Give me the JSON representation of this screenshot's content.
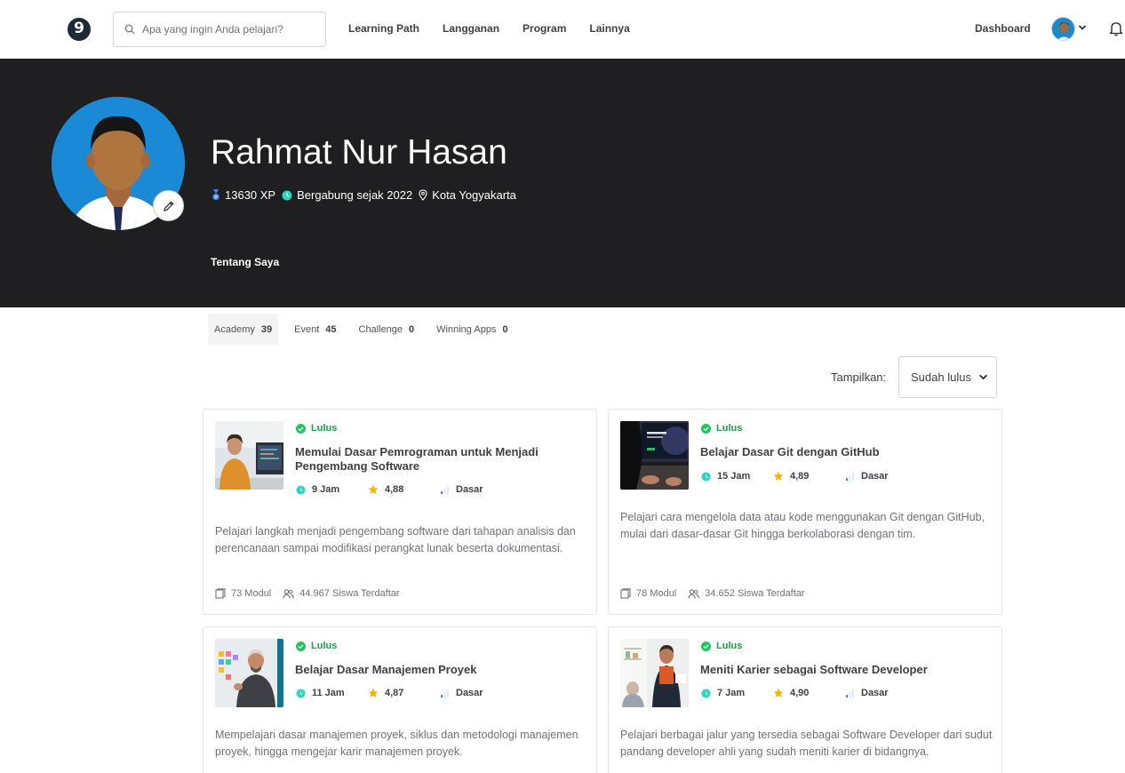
{
  "nav": {
    "logo_text": "9",
    "search_placeholder": "Apa yang ingin Anda pelajari?",
    "links": [
      "Learning Path",
      "Langganan",
      "Program",
      "Lainnya"
    ],
    "dashboard": "Dashboard"
  },
  "profile": {
    "name": "Rahmat Nur Hasan",
    "xp": "13630 XP",
    "joined": "Bergabung sejak 2022",
    "location": "Kota Yogyakarta",
    "about_tab": "Tentang Saya"
  },
  "tabs": [
    {
      "label": "Academy",
      "count": "39",
      "active": true
    },
    {
      "label": "Event",
      "count": "45",
      "active": false
    },
    {
      "label": "Challenge",
      "count": "0",
      "active": false
    },
    {
      "label": "Winning Apps",
      "count": "0",
      "active": false
    }
  ],
  "filter": {
    "label": "Tampilkan:",
    "value": "Sudah lulus"
  },
  "courses": [
    {
      "status": "Lulus",
      "title": "Memulai Dasar Pemrograman untuk Menjadi Pengembang Software",
      "hours": "9 Jam",
      "rating": "4,88",
      "level": "Dasar",
      "description": "Pelajari langkah menjadi pengembang software dari tahapan analisis dan perencanaan sampai modifikasi perangkat lunak beserta dokumentasi.",
      "modules": "73 Modul",
      "students": "44.967 Siswa Terdaftar"
    },
    {
      "status": "Lulus",
      "title": "Belajar Dasar Git dengan GitHub",
      "hours": "15 Jam",
      "rating": "4,89",
      "level": "Dasar",
      "description": "Pelajari cara mengelola data atau kode menggunakan Git dengan GitHub, mulai dari dasar-dasar Git hingga berkolaborasi dengan tim.",
      "modules": "78 Modul",
      "students": "34.652 Siswa Terdaftar"
    },
    {
      "status": "Lulus",
      "title": "Belajar Dasar Manajemen Proyek",
      "hours": "11 Jam",
      "rating": "4,87",
      "level": "Dasar",
      "description": "Mempelajari dasar manajemen proyek, siklus dan metodologi manajemen proyek, hingga mengejar karir manajemen proyek."
    },
    {
      "status": "Lulus",
      "title": "Meniti Karier sebagai Software Developer",
      "hours": "7 Jam",
      "rating": "4,90",
      "level": "Dasar",
      "description": "Pelajari berbagai jalur yang tersedia sebagai Software Developer dari sudut pandang developer ahli yang sudah meniti karier di bidangnya."
    }
  ],
  "colors": {
    "hero_bg": "#1f1f21",
    "status_green": "#16a34a",
    "clock_teal": "#2dd4bf",
    "star_gold": "#f5b400"
  }
}
